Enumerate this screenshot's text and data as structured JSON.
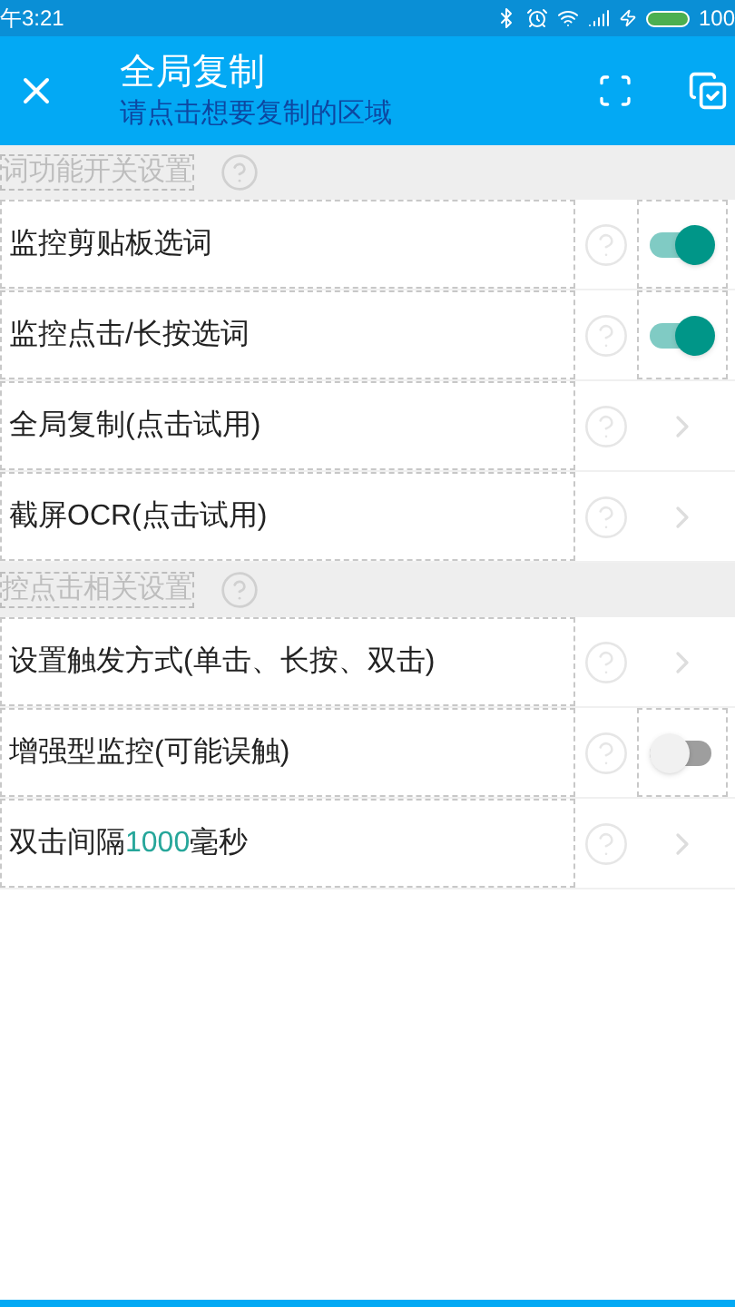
{
  "status_bar": {
    "time": "午3:21",
    "battery": "100"
  },
  "app_bar": {
    "title": "全局复制",
    "subtitle": "请点击想要复制的区域"
  },
  "sections": [
    {
      "title": "词功能开关设置",
      "items": [
        {
          "kind": "toggle",
          "label": "监控剪贴板选词",
          "on": true
        },
        {
          "kind": "toggle",
          "label": "监控点击/长按选词",
          "on": true
        },
        {
          "kind": "arrow",
          "label": "全局复制(点击试用)"
        },
        {
          "kind": "arrow",
          "label": "截屏OCR(点击试用)"
        }
      ]
    },
    {
      "title": "控点击相关设置",
      "items": [
        {
          "kind": "arrow",
          "label": "设置触发方式(单击、长按、双击)"
        },
        {
          "kind": "toggle",
          "label": "增强型监控(可能误触)",
          "on": false
        },
        {
          "kind": "arrow",
          "label": "双击间隔",
          "value": "1000",
          "unit": "毫秒"
        }
      ]
    }
  ]
}
